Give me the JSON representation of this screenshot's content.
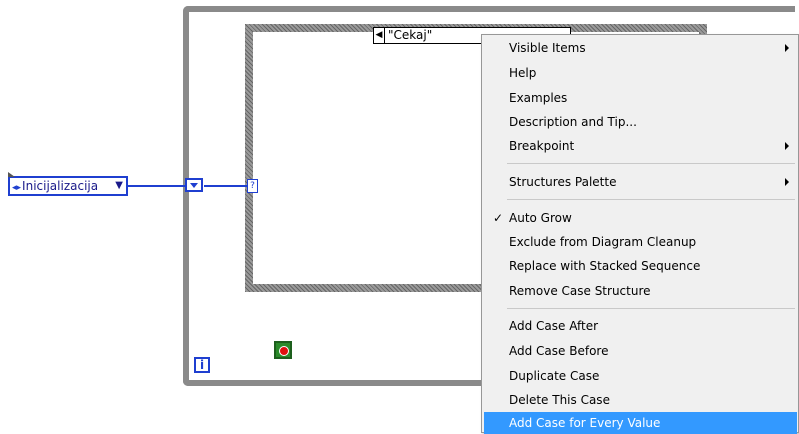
{
  "diagram": {
    "case_selector_value": "\"Cekaj\"",
    "enum_constant_value": "Inicijalizacija",
    "iteration_terminal": "i",
    "selector_terminal": "?"
  },
  "context_menu": {
    "items": [
      {
        "label": "Visible Items",
        "submenu": true
      },
      {
        "label": "Help"
      },
      {
        "label": "Examples"
      },
      {
        "label": "Description and Tip..."
      },
      {
        "label": "Breakpoint",
        "submenu": true
      },
      {
        "label": "Structures Palette",
        "submenu": true
      },
      {
        "label": "Auto Grow",
        "checked": true
      },
      {
        "label": "Exclude from Diagram Cleanup"
      },
      {
        "label": "Replace with Stacked Sequence"
      },
      {
        "label": "Remove Case Structure"
      },
      {
        "label": "Add Case After"
      },
      {
        "label": "Add Case Before"
      },
      {
        "label": "Duplicate Case"
      },
      {
        "label": "Delete This Case"
      },
      {
        "label": "Add Case for Every Value",
        "highlighted": true
      }
    ],
    "check_glyph": "✓"
  },
  "colors": {
    "wire_enum": "#1f3fd0",
    "highlight": "#3399ff",
    "menu_background": "#f0f0f0"
  }
}
